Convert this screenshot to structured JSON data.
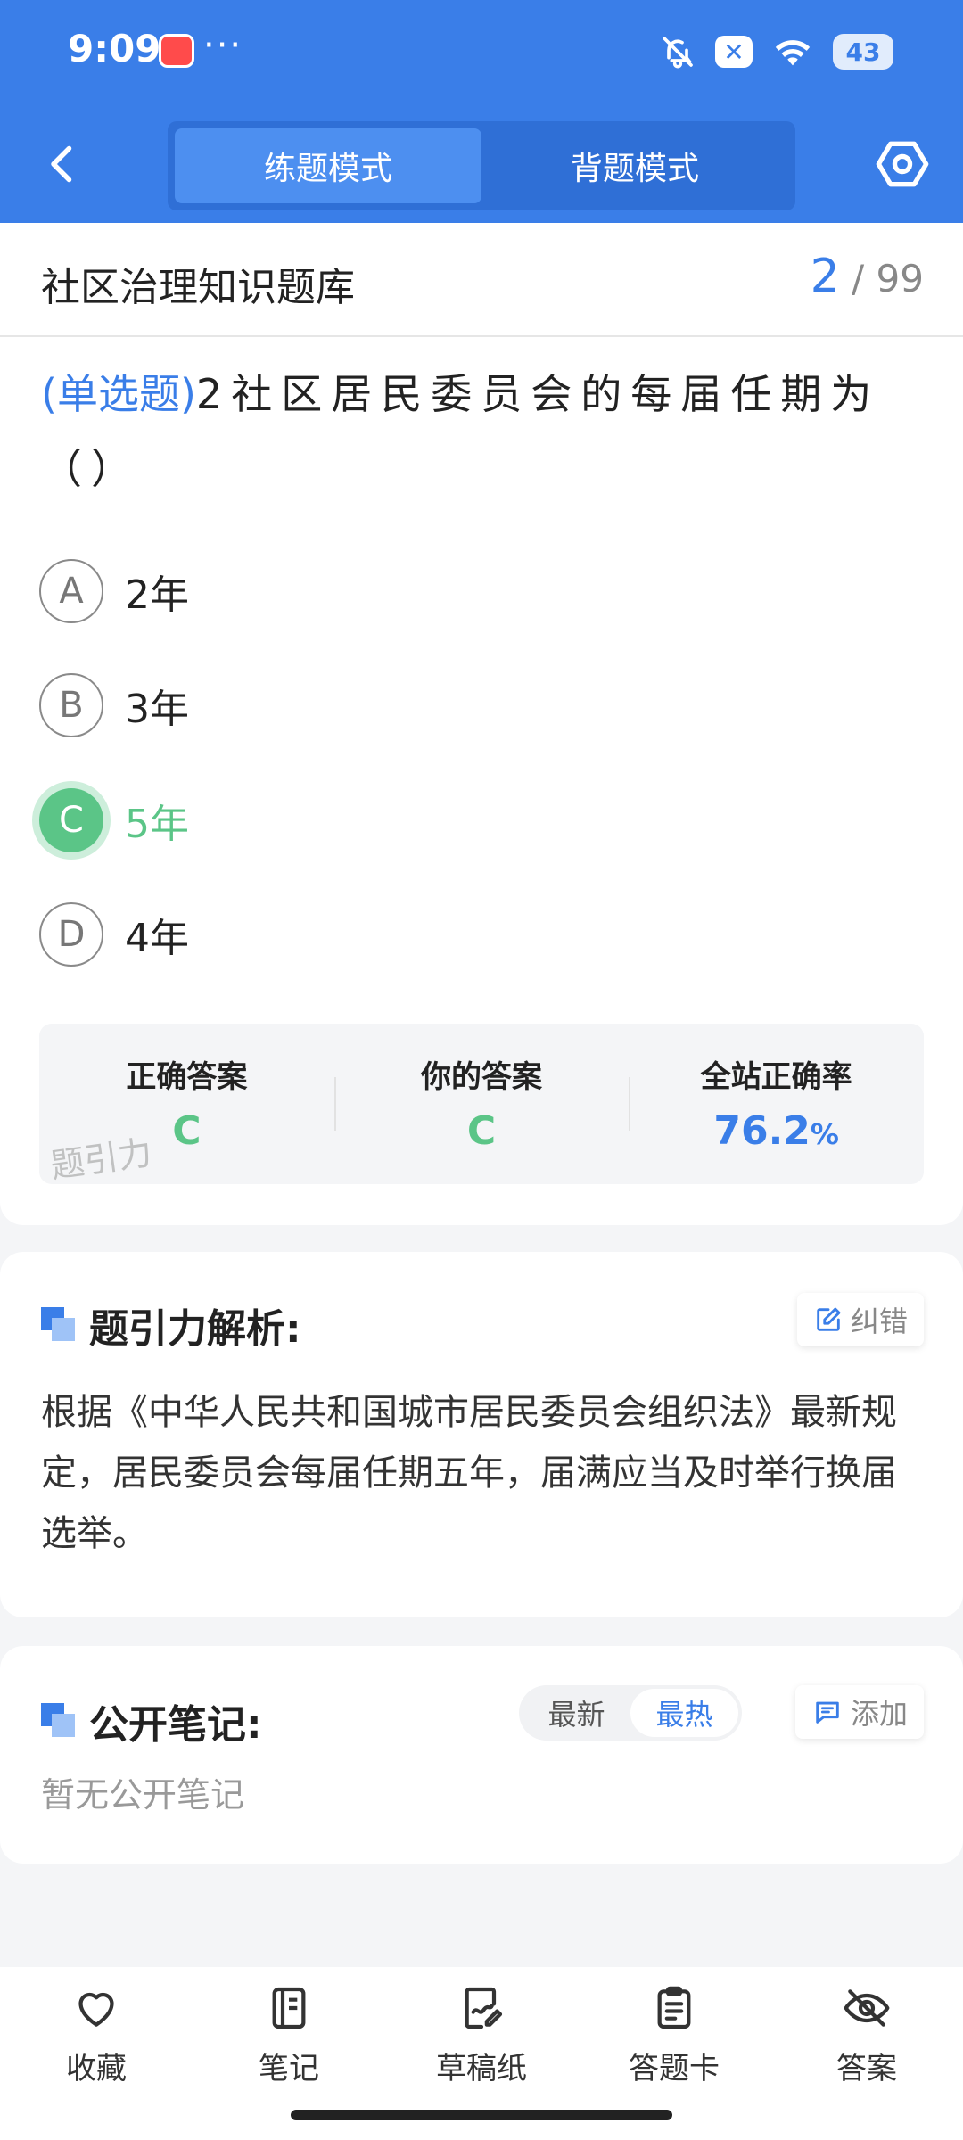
{
  "status_bar": {
    "time": "9:09",
    "dots": "···",
    "battery": "43"
  },
  "header": {
    "tabs": [
      {
        "label": "练题模式",
        "active": true
      },
      {
        "label": "背题模式",
        "active": false
      }
    ]
  },
  "question_bank": {
    "title": "社区治理知识题库",
    "current": "2",
    "separator": "/",
    "total": "99"
  },
  "question": {
    "type": "(单选题)",
    "number": "2",
    "text": "社区居民委员会的每届任期为（）"
  },
  "options": [
    {
      "letter": "A",
      "text": "2年",
      "state": "normal"
    },
    {
      "letter": "B",
      "text": "3年",
      "state": "normal"
    },
    {
      "letter": "C",
      "text": "5年",
      "state": "correct"
    },
    {
      "letter": "D",
      "text": "4年",
      "state": "normal"
    }
  ],
  "stats": {
    "correct_label": "正确答案",
    "correct_value": "C",
    "yours_label": "你的答案",
    "yours_value": "C",
    "rate_label": "全站正确率",
    "rate_value": "76.2",
    "rate_unit": "%"
  },
  "watermark": "题引力",
  "analysis": {
    "title": "题引力解析:",
    "error_button": "纠错",
    "text": "根据《中华人民共和国城市居民委员会组织法》最新规定，居民委员会每届任期五年，届满应当及时举行换届选举。"
  },
  "notes": {
    "title": "公开笔记:",
    "sort_options": [
      "最新",
      "最热"
    ],
    "sort_selected": "最热",
    "add_button": "添加",
    "empty_text": "暂无公开笔记"
  },
  "bottom_tabs": [
    {
      "label": "收藏",
      "icon": "heart-icon"
    },
    {
      "label": "笔记",
      "icon": "notebook-icon"
    },
    {
      "label": "草稿纸",
      "icon": "draft-paper-icon"
    },
    {
      "label": "答题卡",
      "icon": "answer-sheet-icon"
    },
    {
      "label": "答案",
      "icon": "eye-off-icon"
    }
  ],
  "colors": {
    "primary": "#3a7ee8",
    "correct": "#5bc587"
  }
}
